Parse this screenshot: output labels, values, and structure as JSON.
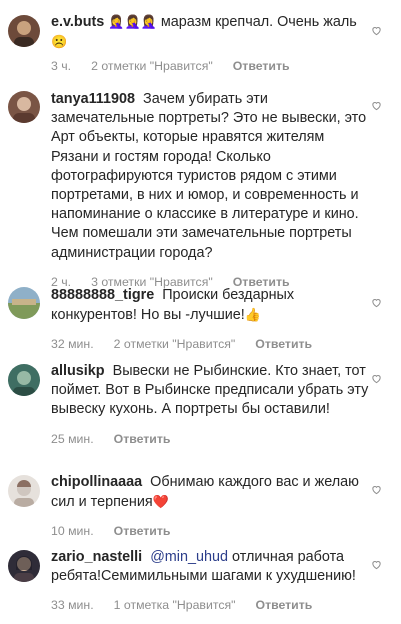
{
  "comments": [
    {
      "username": "e.v.buts",
      "emojis_inline": "🤦‍♀️🤦‍♀️🤦‍♀️",
      "text": "маразм крепчал. Очень жаль",
      "trailing_emoji": "☹️",
      "time": "3 ч.",
      "likes": "2 отметки \"Нравится\"",
      "reply": "Ответить",
      "avatar_colors": [
        "#6d4a3a",
        "#c9a27e"
      ]
    },
    {
      "username": "tanya111908",
      "text": "Зачем убирать эти замечательные портреты? Это не вывески, это Арт объекты, которые нравятся жителям Рязани и гостям города! Сколько фотографируются туристов рядом с этими портретами, в них и юмор, и современность и напоминание о классике в литературе и кино. Чем помешали эти замечательные портреты администрации города?",
      "time": "2 ч.",
      "likes": "3 отметки \"Нравится\"",
      "reply": "Ответить",
      "avatar_colors": [
        "#7a5545",
        "#d8b8a0"
      ]
    },
    {
      "username": "88888888_tigre",
      "text": "Происки бездарных конкурентов! Но вы -лучшие!",
      "trailing_emoji": "👍",
      "time": "32 мин.",
      "likes": "2 отметки \"Нравится\"",
      "reply": "Ответить",
      "avatar_colors": [
        "#7f9a5a",
        "#c7b38a"
      ]
    },
    {
      "username": "allusikp",
      "text": "Вывески не Рыбинские. Кто знает, тот поймет.  Вот в Рыбинске предписали убрать эту вывеску кухонь. А портреты бы оставили!",
      "time": "25 мин.",
      "reply": "Ответить",
      "avatar_colors": [
        "#3f6e63",
        "#97b9a5"
      ]
    },
    {
      "username": "chipollinaaaa",
      "text": "Обнимаю каждого вас и желаю сил и терпения",
      "trailing_emoji": "❤️",
      "time": "10 мин.",
      "reply": "Ответить",
      "avatar_colors": [
        "#cfc6bf",
        "#8b6f62"
      ]
    },
    {
      "username": "zario_nastelli",
      "mention": "@min_uhud",
      "text": "отличная работа ребята!Семимильными шагами к ухудшению!",
      "time": "33 мин.",
      "likes": "1 отметка \"Нравится\"",
      "reply": "Ответить",
      "avatar_colors": [
        "#2f2c38",
        "#d2b49a"
      ]
    }
  ],
  "colors": {
    "text": "#262626",
    "meta": "#8e8e8e",
    "mention": "#2c3e8b",
    "heart_stroke": "#8e8e8e"
  }
}
